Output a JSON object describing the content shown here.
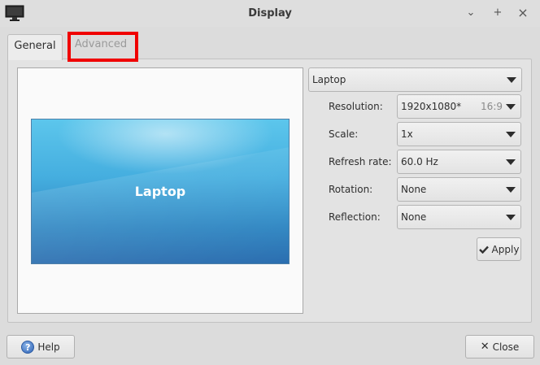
{
  "window": {
    "title": "Display",
    "minimize_glyph": "⌄",
    "maximize_glyph": "+",
    "close_glyph": "×"
  },
  "tabs": [
    {
      "label": "General",
      "active": true
    },
    {
      "label": "Advanced",
      "active": false
    }
  ],
  "preview": {
    "display_name": "Laptop"
  },
  "display_select": {
    "value": "Laptop"
  },
  "settings": {
    "resolution": {
      "label": "Resolution:",
      "value": "1920x1080*",
      "aspect": "16:9"
    },
    "scale": {
      "label": "Scale:",
      "value": "1x"
    },
    "refresh_rate": {
      "label": "Refresh rate:",
      "value": "60.0 Hz"
    },
    "rotation": {
      "label": "Rotation:",
      "value": "None"
    },
    "reflection": {
      "label": "Reflection:",
      "value": "None"
    }
  },
  "buttons": {
    "apply": "Apply",
    "help": "Help",
    "close": "Close"
  },
  "colors": {
    "highlight": "#f00000",
    "preview_blue": "#3b9fd9"
  }
}
